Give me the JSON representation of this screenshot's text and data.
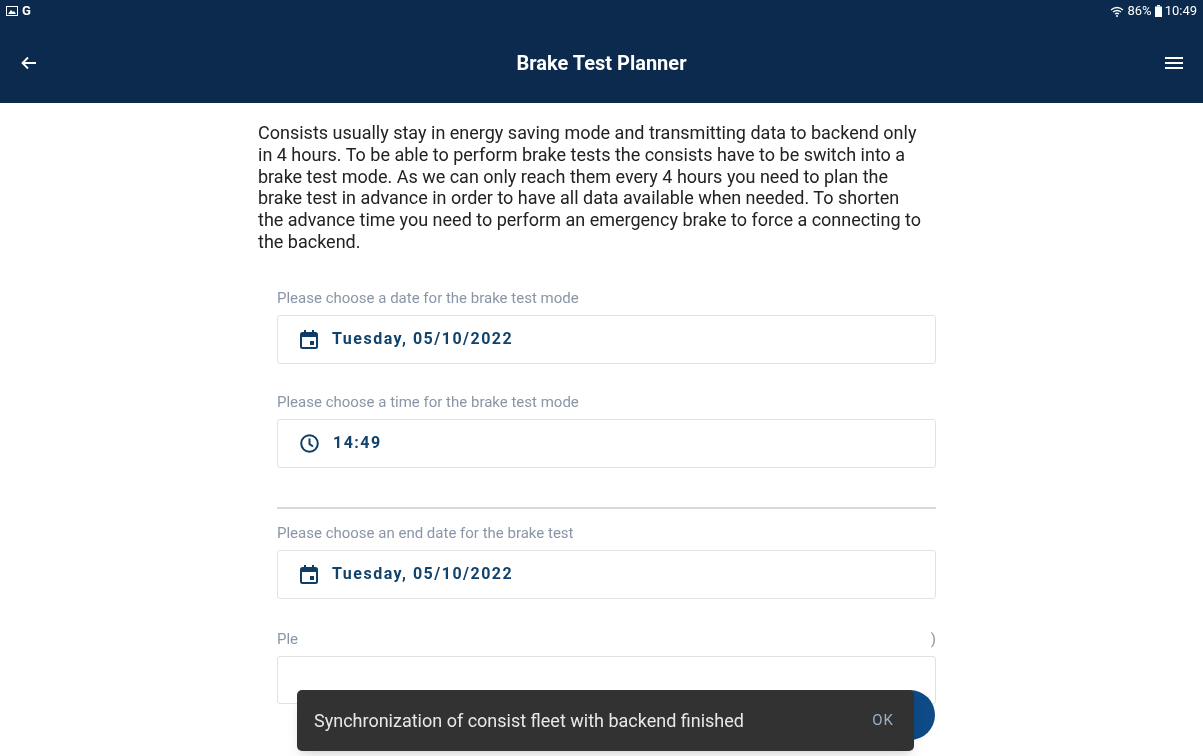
{
  "status_bar": {
    "left_icons": [
      "G"
    ],
    "battery": "86%",
    "time": "10:49"
  },
  "header": {
    "title": "Brake Test Planner"
  },
  "intro": "Consists usually stay in energy saving mode and transmitting data to backend only in 4 hours. To be able to perform brake tests the consists have to be switch into a brake test mode. As we can only reach them every 4 hours you need to plan the brake test in advance in order to have all data available when needed. To shorten the advance time you need to perform an emergency brake to force a connecting to the backend.",
  "fields": [
    {
      "kind": "date",
      "label": "Please choose a date for the brake test mode",
      "value": "Tuesday, 05/10/2022"
    },
    {
      "kind": "time",
      "label": "Please choose a time for the brake test mode",
      "value": "14:49"
    },
    {
      "kind": "divider"
    },
    {
      "kind": "date",
      "label": "Please choose an end date for the brake test",
      "value": "Tuesday, 05/10/2022"
    },
    {
      "kind": "partial",
      "label": "Ple",
      "label_end": ")"
    }
  ],
  "snackbar": {
    "message": "Synchronization of consist fleet with backend finished",
    "action": "OK"
  }
}
